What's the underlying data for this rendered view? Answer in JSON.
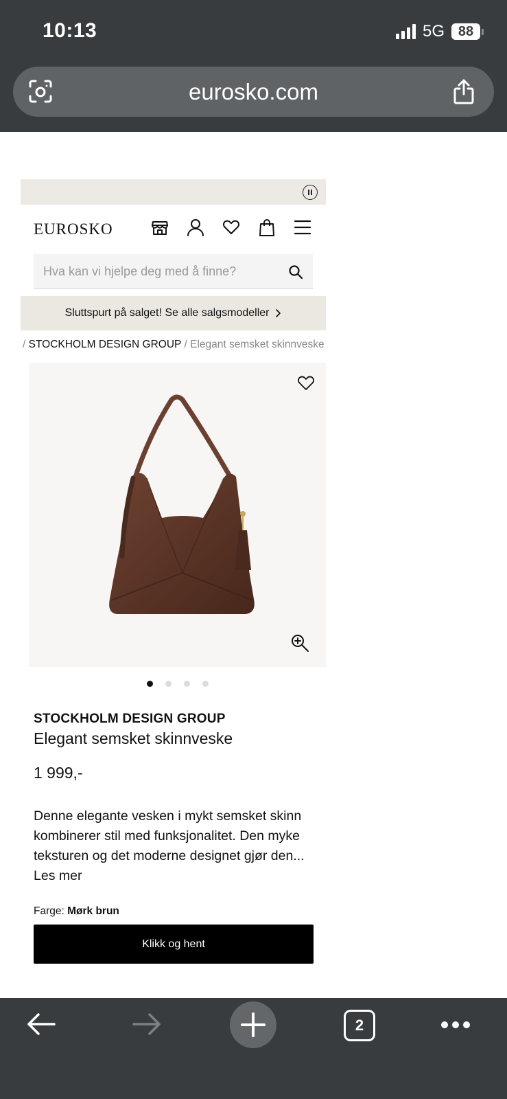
{
  "status": {
    "time": "10:13",
    "network": "5G",
    "battery": "88"
  },
  "browser": {
    "url": "eurosko.com",
    "tab_count": "2"
  },
  "header": {
    "logo": "EUROSKO"
  },
  "search": {
    "placeholder": "Hva kan vi hjelpe deg med å finne?"
  },
  "sale_banner": "Sluttspurt på salget! Se alle salgsmodeller",
  "breadcrumb": {
    "sep1": "/",
    "brand": "STOCKHOLM DESIGN GROUP",
    "sep2": "/",
    "current": "Elegant semsket skinnveske"
  },
  "gallery": {
    "image_count": 4,
    "active_index": 0
  },
  "product": {
    "brand": "STOCKHOLM DESIGN GROUP",
    "name": "Elegant semsket skinnveske",
    "price": "1 999,-",
    "description": "Denne elegante vesken i mykt semsket skinn kombinerer stil med funksjonalitet. Den myke teksturen og det moderne designet gjør den...",
    "read_more": "Les mer",
    "color_label": "Farge:",
    "color_value": "Mørk brun",
    "cta": "Klikk og hent"
  },
  "colors": {
    "chrome": "#383c3f",
    "url_bar": "#5f6366",
    "banner": "#ebe7e1",
    "bag": "#5a3426",
    "cta": "#000000"
  }
}
